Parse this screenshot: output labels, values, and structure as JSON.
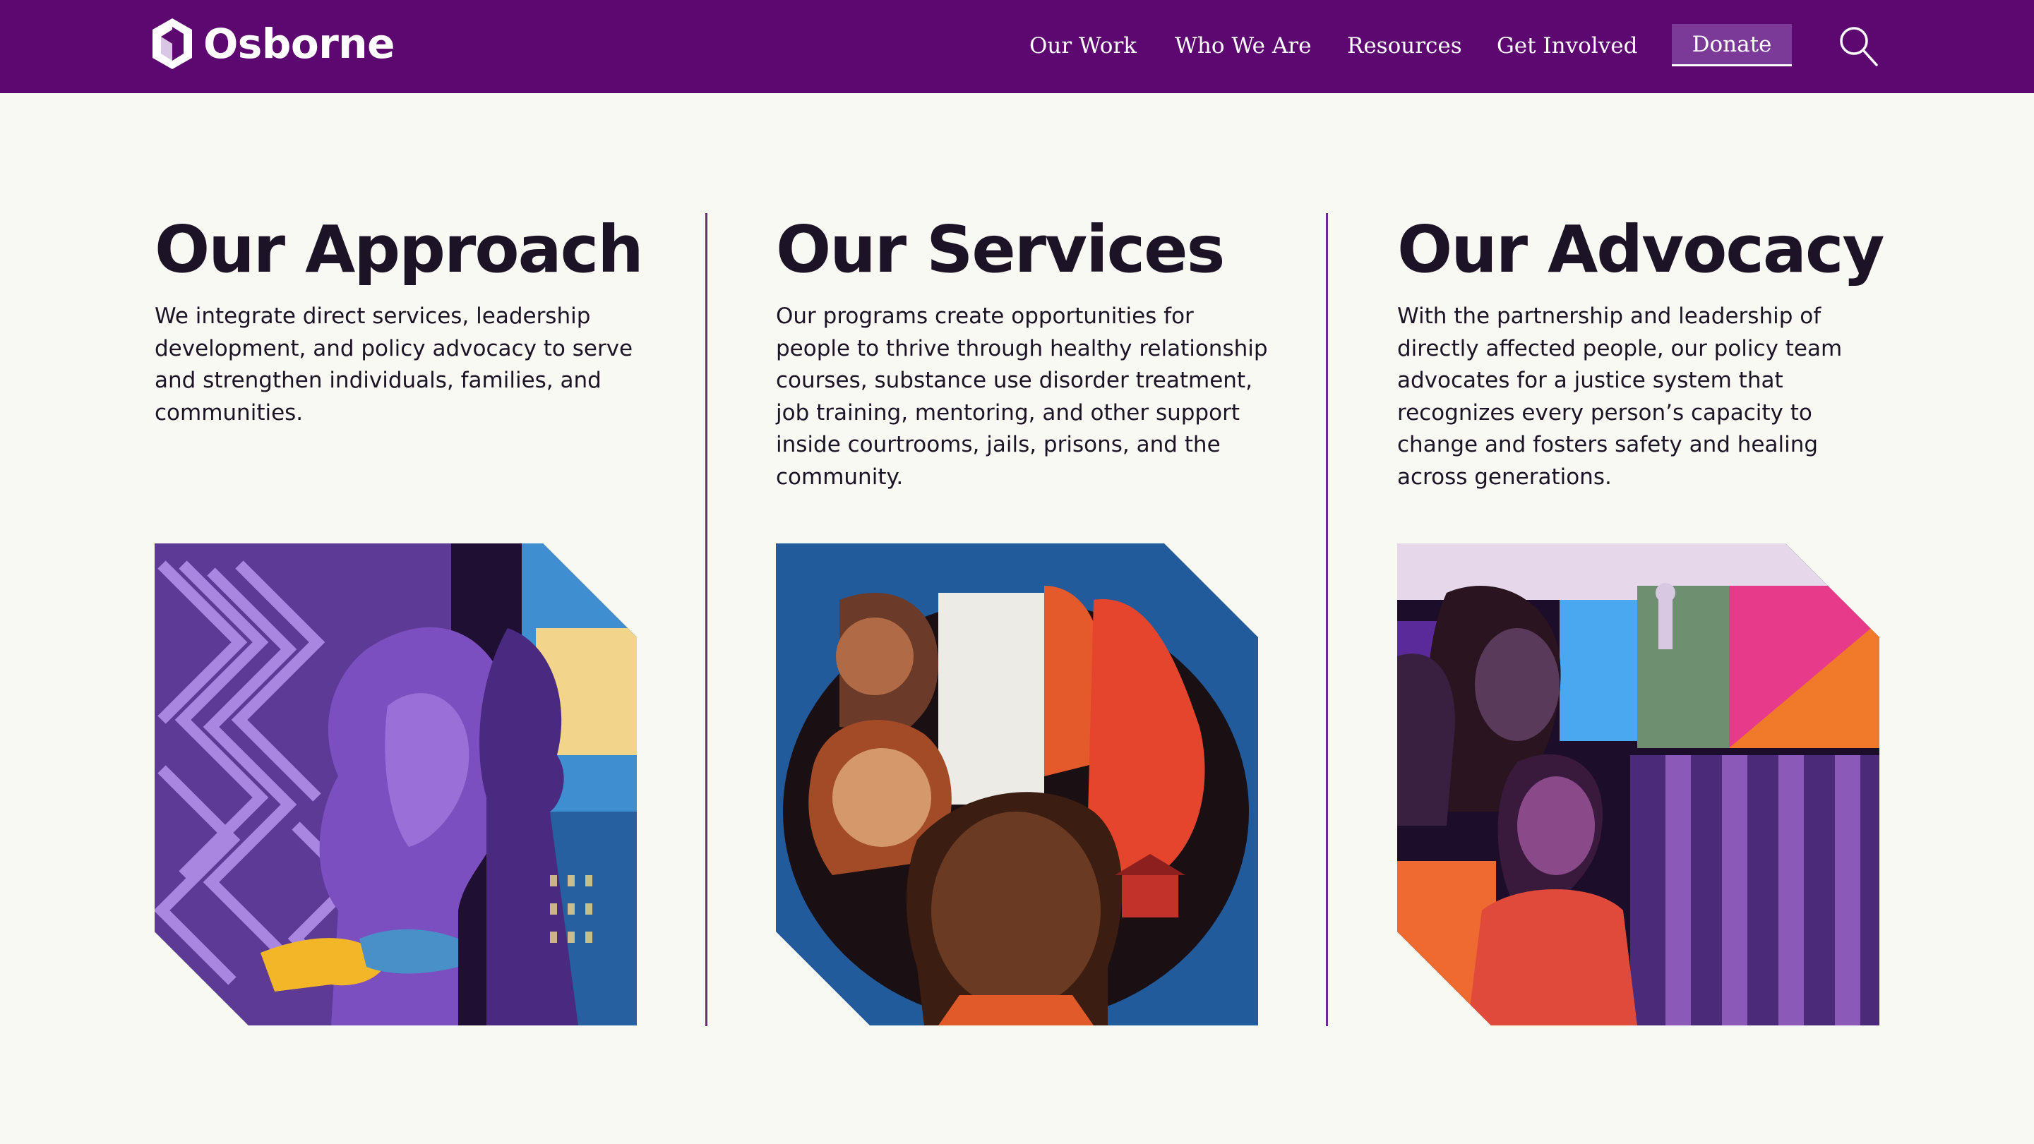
{
  "header": {
    "brand": "Osborne",
    "nav": [
      "Our Work",
      "Who We Are",
      "Resources",
      "Get Involved"
    ],
    "donate_label": "Donate",
    "search_icon": "search-icon",
    "colors": {
      "bar": "#5c0870",
      "donate_bg": "#7c3a98"
    }
  },
  "sections": [
    {
      "title": "Our Approach",
      "body": "We integrate direct services, leadership development, and policy advocacy to serve and strengthen individuals, families, and communities.",
      "image": "maze-profiles-illustration"
    },
    {
      "title": "Our Services",
      "body": "Our programs create opportunities for people to thrive through healthy relationship courses, substance use disorder treatment, job training, mentoring, and other support inside courtrooms, jails, prisons, and the community.",
      "image": "community-portraits-illustration"
    },
    {
      "title": "Our Advocacy",
      "body": "With the partnership and leadership of directly affected people, our policy team advocates for a justice system that recognizes every person’s capacity to change and fosters safety and healing across generations.",
      "image": "courthouse-portraits-illustration"
    }
  ],
  "colors": {
    "page_bg": "#f9f9f3",
    "divider": "#6a2c88",
    "text": "#1c1426"
  }
}
